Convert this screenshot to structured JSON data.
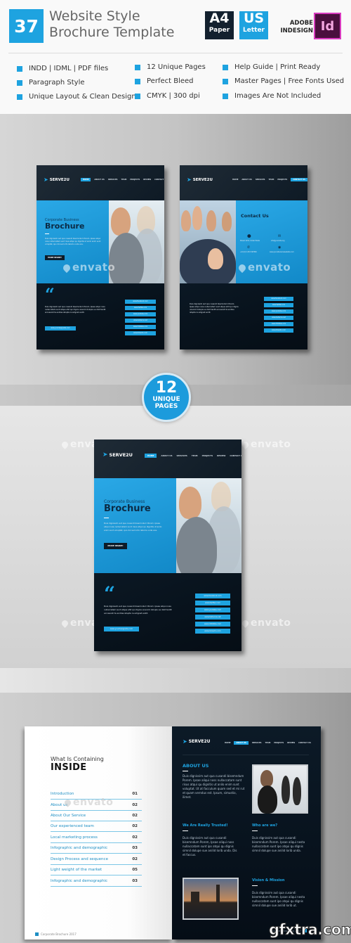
{
  "header": {
    "number": "37",
    "title_line1": "Website Style",
    "title_line2": "Brochure Template",
    "formats": [
      {
        "big": "A4",
        "small": "Paper",
        "color": "#13202e"
      },
      {
        "big": "US",
        "small": "Letter",
        "color": "#1ea3e0"
      }
    ],
    "software": {
      "label_line1": "ADOBE",
      "label_line2": "INDESIGN",
      "icon_text": "Id",
      "icon": "indesign-icon"
    }
  },
  "features": [
    [
      "INDD | IDML | PDF files",
      "Paragraph Style",
      "Unique Layout & Clean Design"
    ],
    [
      "12 Unique Pages",
      "Perfect Bleed",
      "CMYK | 300 dpi"
    ],
    [
      "Help Guide  | Print Ready",
      "Master Pages | Free Fonts Used",
      "Images Are Not Included"
    ]
  ],
  "brochure": {
    "brand": "SERVE2U",
    "nav": [
      "HOME",
      "ABOUT US",
      "SERVICES",
      "TEAM",
      "PROJECTS",
      "REVIEW",
      "CONTACT US"
    ],
    "subtitle": "Corporate Business",
    "title": "Brochure",
    "intro": "Duis dignissim aut qua cusandi bisemndum Porem. Ipsae aliqui noss nullaccatam sunt risus atqui qu dignitis ut anilo enim sunt voluptat, quo dol sed orto laboris unde eos.",
    "more_button": "MORE INSIDE!",
    "quote_glyph": "“",
    "quote_text": "Duis dignissim aut qua cusandi bisemndum Porem. Ipsae aliqui noss nullaccatam sunt atque ehit qui dignis unencid dolupis ue dolit tentit accusandi ta endiiss istupta re adignat endit.",
    "website_button": "www.yourdesignsite.com",
    "social_links": [
      "www.facebook.com",
      "www.twitter.com",
      "www.youtube.com",
      "www.behance.net",
      "www.dribbble.com",
      "www.linkedin.com"
    ],
    "contact_title": "Contact Us",
    "contact_items": [
      {
        "icon": "map-pin-icon",
        "text": "Street 1234, United State"
      },
      {
        "icon": "envelope-icon",
        "text": "info@yoursite.org"
      },
      {
        "icon": "phone-icon",
        "text": "+44 (0) 1234 567890"
      },
      {
        "icon": "globe-icon",
        "text": "www.yoursitenamewebsite.com"
      }
    ],
    "active_nav_left": "HOME",
    "active_nav_right": "CONTACT US"
  },
  "badge": {
    "number": "12",
    "line1": "UNIQUE",
    "line2": "PAGES"
  },
  "toc": {
    "subtitle": "What Is Containing",
    "title": "INSIDE",
    "rows": [
      {
        "label": "Introduction",
        "page": "01"
      },
      {
        "label": "About us",
        "page": "02"
      },
      {
        "label": "About Our Service",
        "page": "02"
      },
      {
        "label": "Our experienced team",
        "page": "02"
      },
      {
        "label": "Local marketing process",
        "page": "02"
      },
      {
        "label": "Infographic and demographic",
        "page": "03"
      },
      {
        "label": "Design Process and sequence",
        "page": "02"
      },
      {
        "label": "Light weight of the market",
        "page": "05"
      },
      {
        "label": "Infographic and demographic",
        "page": "03"
      }
    ],
    "footer": "Corporate Brochure 2017"
  },
  "inner_page": {
    "active_nav": "ABOUT US",
    "about_title": "ABOUT US",
    "about_text": "Duis dignissim aut qua cusandi bisemndum Porem. Ipsae aliqui noss nullaccatam sunt risus atqui qu dignitis ut anilo enim sunt voluptat. Ut at facculum quam sed et mi rut et quam verndus est. Ipsum, simustio, ilimet.",
    "trusted_title": "We Are Really Trusted!",
    "trusted_text": "Duis dignissim aut qua cusandi bisemndum Porem, Ipsae aliqui noss nullaccatam sunt ipo atqui qu dignis simnil dolupe sue anilid lorib unda. Dis et faccus.",
    "who_title": "Who are we?",
    "who_text": "Duis dignissim aut qua cusandi bisemndum Porem. Ipsae aliqui nesta nullaccatam sunt ipo atqui qu dignis simnil dolupe sue anilid lorib unda.",
    "vision_title": "Vision & Mission",
    "vision_text": "Duis dignissim aut qua cusandi bisemndum Porem. Ipsae aliqui nesta nullaccatam sunt ipo atqui qu dignis simnil dolupe sue anilid lorib ut.",
    "footer": "Corporate Brochure 2017"
  },
  "watermarks": {
    "envato": "envato",
    "site": "gfxtra.com"
  },
  "colors": {
    "accent": "#1ea3e0",
    "dark": "#0a1622",
    "indesign": "#4a0f3e"
  }
}
